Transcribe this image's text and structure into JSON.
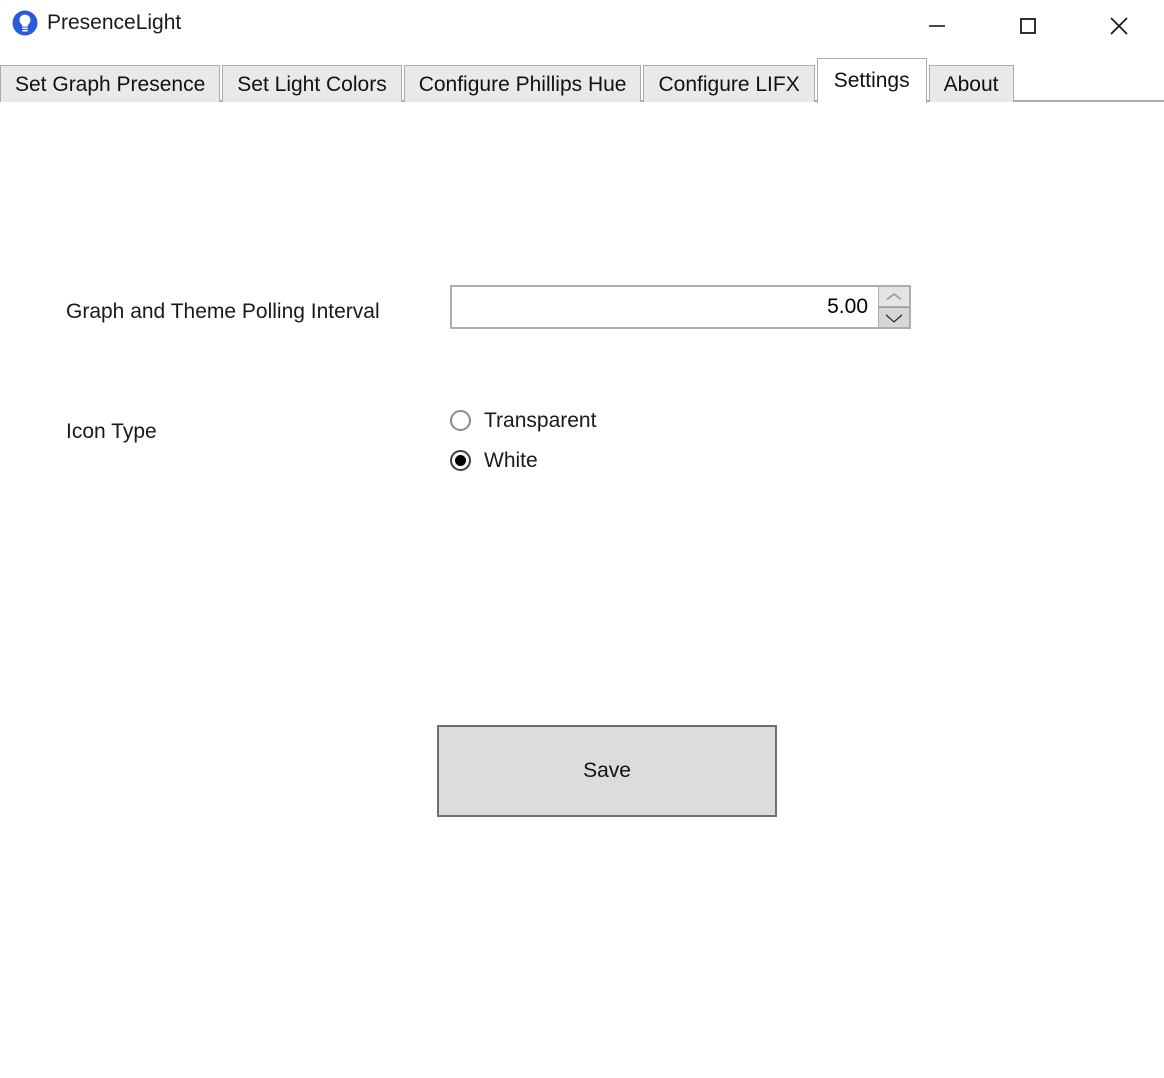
{
  "window": {
    "title": "PresenceLight",
    "app_icon": "lightbulb-icon",
    "icon_color": "#2a5bd7",
    "controls": {
      "minimize": "minimize-icon",
      "maximize": "maximize-icon",
      "close": "close-icon"
    }
  },
  "tabs": [
    {
      "label": "Set Graph Presence",
      "active": false
    },
    {
      "label": "Set Light Colors",
      "active": false
    },
    {
      "label": "Configure Phillips Hue",
      "active": false
    },
    {
      "label": "Configure LIFX",
      "active": false
    },
    {
      "label": "Settings",
      "active": true
    },
    {
      "label": "About",
      "active": false
    }
  ],
  "settings": {
    "polling": {
      "label": "Graph and Theme Polling Interval",
      "value": "5.00",
      "spinner_up": "chevron-up-icon",
      "spinner_down": "chevron-down-icon"
    },
    "icon_type": {
      "label": "Icon Type",
      "options": [
        {
          "label": "Transparent",
          "selected": false
        },
        {
          "label": "White",
          "selected": true
        }
      ]
    },
    "save_label": "Save"
  },
  "colors": {
    "tab_inactive_bg": "#e9e9e9",
    "tab_active_bg": "#ffffff",
    "border": "#acacac",
    "button_bg": "#dcdcdc",
    "button_border": "#707070"
  }
}
